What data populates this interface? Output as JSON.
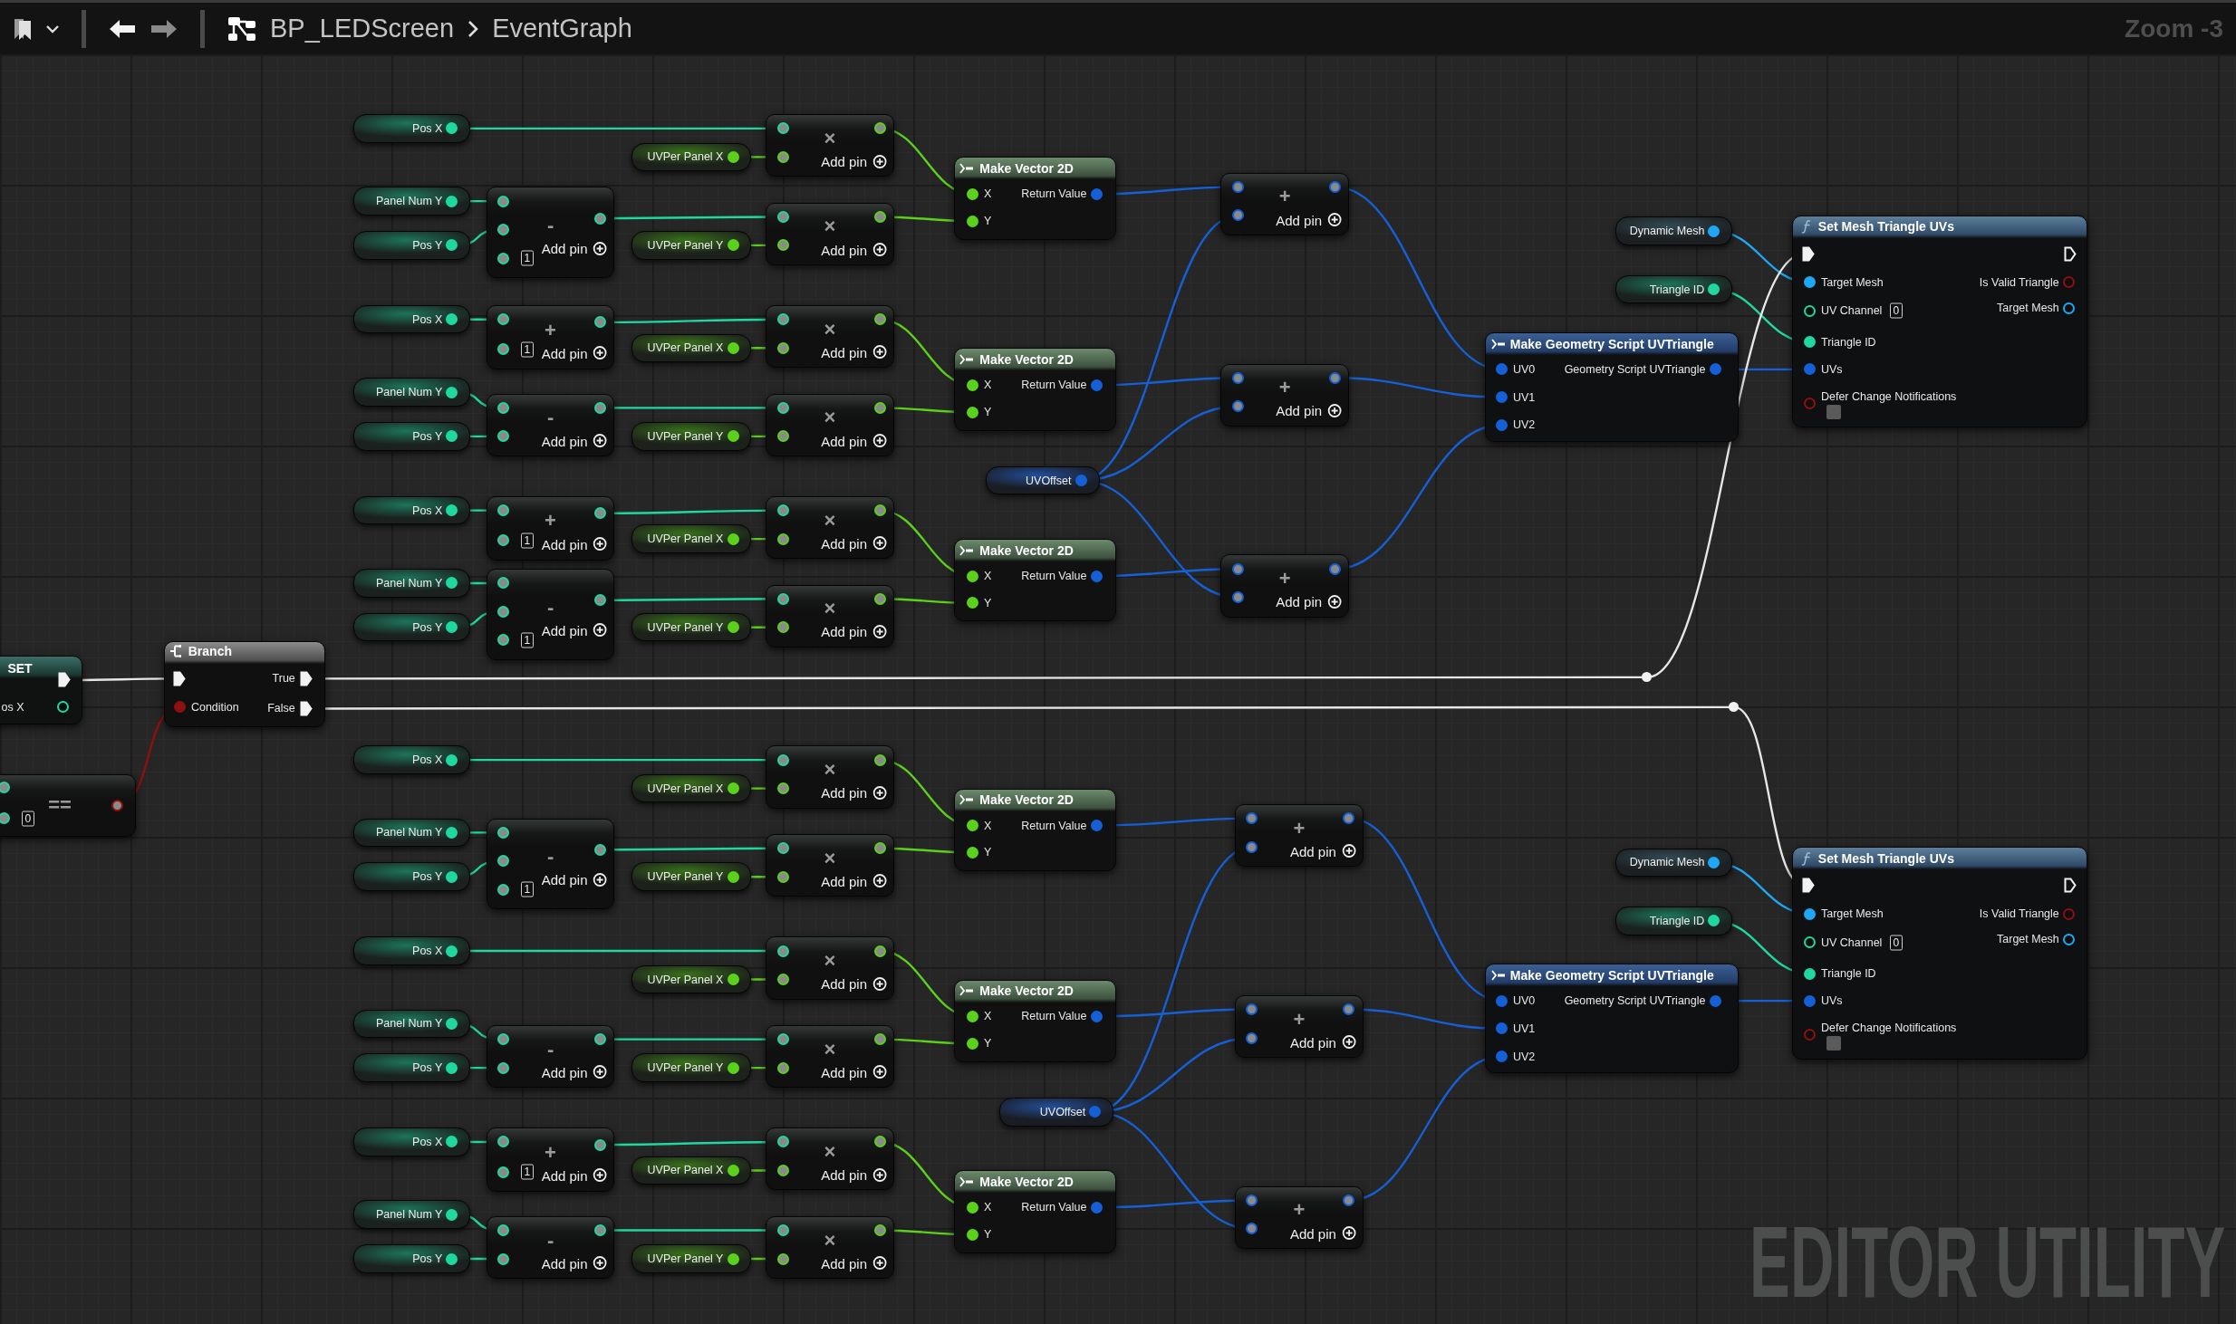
{
  "toolbar": {
    "breadcrumb": [
      "BP_LEDScreen",
      "EventGraph"
    ],
    "zoom": "Zoom -3"
  },
  "set_node": {
    "title": "SET",
    "pin": "os X"
  },
  "equals_node": {
    "operator": "==",
    "default": "0"
  },
  "branch_node": {
    "title": "Branch",
    "condition": "Condition",
    "true": "True",
    "false": "False"
  },
  "groups": [
    {
      "blocks": [
        {
          "x_chain": {
            "inputs": [
              "Pos X"
            ],
            "factor": "UVPer Panel X",
            "multiply": {
              "symbol": "×",
              "add_pin": "Add pin"
            }
          },
          "y_chain": {
            "inputs": [
              "Panel Num Y",
              "Pos Y"
            ],
            "op": {
              "symbol": "-",
              "default": "1",
              "add_pin": "Add pin"
            },
            "factor": "UVPer Panel Y",
            "multiply": {
              "symbol": "×",
              "add_pin": "Add pin"
            }
          },
          "make_vector": {
            "title": "Make Vector 2D",
            "inputs": [
              "X",
              "Y"
            ],
            "output": "Return Value"
          },
          "add": {
            "symbol": "+",
            "add_pin": "Add pin"
          }
        },
        {
          "x_chain": {
            "inputs": [
              "Pos X"
            ],
            "op": {
              "symbol": "+",
              "default": "1",
              "add_pin": "Add pin"
            },
            "factor": "UVPer Panel X",
            "multiply": {
              "symbol": "×",
              "add_pin": "Add pin"
            }
          },
          "y_chain": {
            "inputs": [
              "Panel Num Y",
              "Pos Y"
            ],
            "op": {
              "symbol": "-",
              "add_pin": "Add pin"
            },
            "factor": "UVPer Panel Y",
            "multiply": {
              "symbol": "×",
              "add_pin": "Add pin"
            }
          },
          "make_vector": {
            "title": "Make Vector 2D",
            "inputs": [
              "X",
              "Y"
            ],
            "output": "Return Value"
          },
          "add": {
            "symbol": "+",
            "add_pin": "Add pin"
          }
        },
        {
          "x_chain": {
            "inputs": [
              "Pos X"
            ],
            "op": {
              "symbol": "+",
              "default": "1",
              "add_pin": "Add pin"
            },
            "factor": "UVPer Panel X",
            "multiply": {
              "symbol": "×",
              "add_pin": "Add pin"
            }
          },
          "y_chain": {
            "inputs": [
              "Panel Num Y",
              "Pos Y"
            ],
            "op": {
              "symbol": "-",
              "default": "1",
              "add_pin": "Add pin"
            },
            "factor": "UVPer Panel Y",
            "multiply": {
              "symbol": "×",
              "add_pin": "Add pin"
            }
          },
          "make_vector": {
            "title": "Make Vector 2D",
            "inputs": [
              "X",
              "Y"
            ],
            "output": "Return Value"
          },
          "add": {
            "symbol": "+",
            "add_pin": "Add pin"
          }
        }
      ],
      "uv_offset": "UVOffset",
      "make_triangle": {
        "title": "Make Geometry Script UVTriangle",
        "inputs": [
          "UV0",
          "UV1",
          "UV2"
        ],
        "output": "Geometry Script UVTriangle"
      },
      "dynamic_mesh": "Dynamic Mesh",
      "triangle_id": "Triangle ID",
      "set_uvs": {
        "title": "Set Mesh Triangle UVs",
        "inputs": [
          "Target Mesh",
          "UV Channel",
          "Triangle ID",
          "UVs"
        ],
        "uv_channel_default": "0",
        "defer_label": "Defer Change Notifications",
        "defer_checked": false,
        "outputs": [
          "Is Valid Triangle",
          "Target Mesh"
        ]
      }
    },
    {
      "blocks": [
        {
          "x_chain": {
            "inputs": [
              "Pos X"
            ],
            "factor": "UVPer Panel X",
            "multiply": {
              "symbol": "×",
              "add_pin": "Add pin"
            }
          },
          "y_chain": {
            "inputs": [
              "Panel Num Y",
              "Pos Y"
            ],
            "op": {
              "symbol": "-",
              "default": "1",
              "add_pin": "Add pin"
            },
            "factor": "UVPer Panel Y",
            "multiply": {
              "symbol": "×",
              "add_pin": "Add pin"
            }
          },
          "make_vector": {
            "title": "Make Vector 2D",
            "inputs": [
              "X",
              "Y"
            ],
            "output": "Return Value"
          },
          "add": {
            "symbol": "+",
            "add_pin": "Add pin"
          }
        },
        {
          "x_chain": {
            "inputs": [
              "Pos X"
            ],
            "factor": "UVPer Panel X",
            "multiply": {
              "symbol": "×",
              "add_pin": "Add pin"
            }
          },
          "y_chain": {
            "inputs": [
              "Panel Num Y",
              "Pos Y"
            ],
            "op": {
              "symbol": "-",
              "add_pin": "Add pin"
            },
            "factor": "UVPer Panel Y",
            "multiply": {
              "symbol": "×",
              "add_pin": "Add pin"
            }
          },
          "make_vector": {
            "title": "Make Vector 2D",
            "inputs": [
              "X",
              "Y"
            ],
            "output": "Return Value"
          },
          "add": {
            "symbol": "+",
            "add_pin": "Add pin"
          }
        },
        {
          "x_chain": {
            "inputs": [
              "Pos X"
            ],
            "op": {
              "symbol": "+",
              "default": "1",
              "add_pin": "Add pin"
            },
            "factor": "UVPer Panel X",
            "multiply": {
              "symbol": "×",
              "add_pin": "Add pin"
            }
          },
          "y_chain": {
            "inputs": [
              "Panel Num Y",
              "Pos Y"
            ],
            "op": {
              "symbol": "-",
              "add_pin": "Add pin"
            },
            "factor": "UVPer Panel Y",
            "multiply": {
              "symbol": "×",
              "add_pin": "Add pin"
            }
          },
          "make_vector": {
            "title": "Make Vector 2D",
            "inputs": [
              "X",
              "Y"
            ],
            "output": "Return Value"
          },
          "add": {
            "symbol": "+",
            "add_pin": "Add pin"
          }
        }
      ],
      "uv_offset": "UVOffset",
      "make_triangle": {
        "title": "Make Geometry Script UVTriangle",
        "inputs": [
          "UV0",
          "UV1",
          "UV2"
        ],
        "output": "Geometry Script UVTriangle"
      },
      "dynamic_mesh": "Dynamic Mesh",
      "triangle_id": "Triangle ID",
      "set_uvs": {
        "title": "Set Mesh Triangle UVs",
        "inputs": [
          "Target Mesh",
          "UV Channel",
          "Triangle ID",
          "UVs"
        ],
        "uv_channel_default": "0",
        "defer_label": "Defer Change Notifications",
        "defer_checked": false,
        "outputs": [
          "Is Valid Triangle",
          "Target Mesh"
        ]
      }
    }
  ],
  "graph_label": "EDITOR UTILITY"
}
